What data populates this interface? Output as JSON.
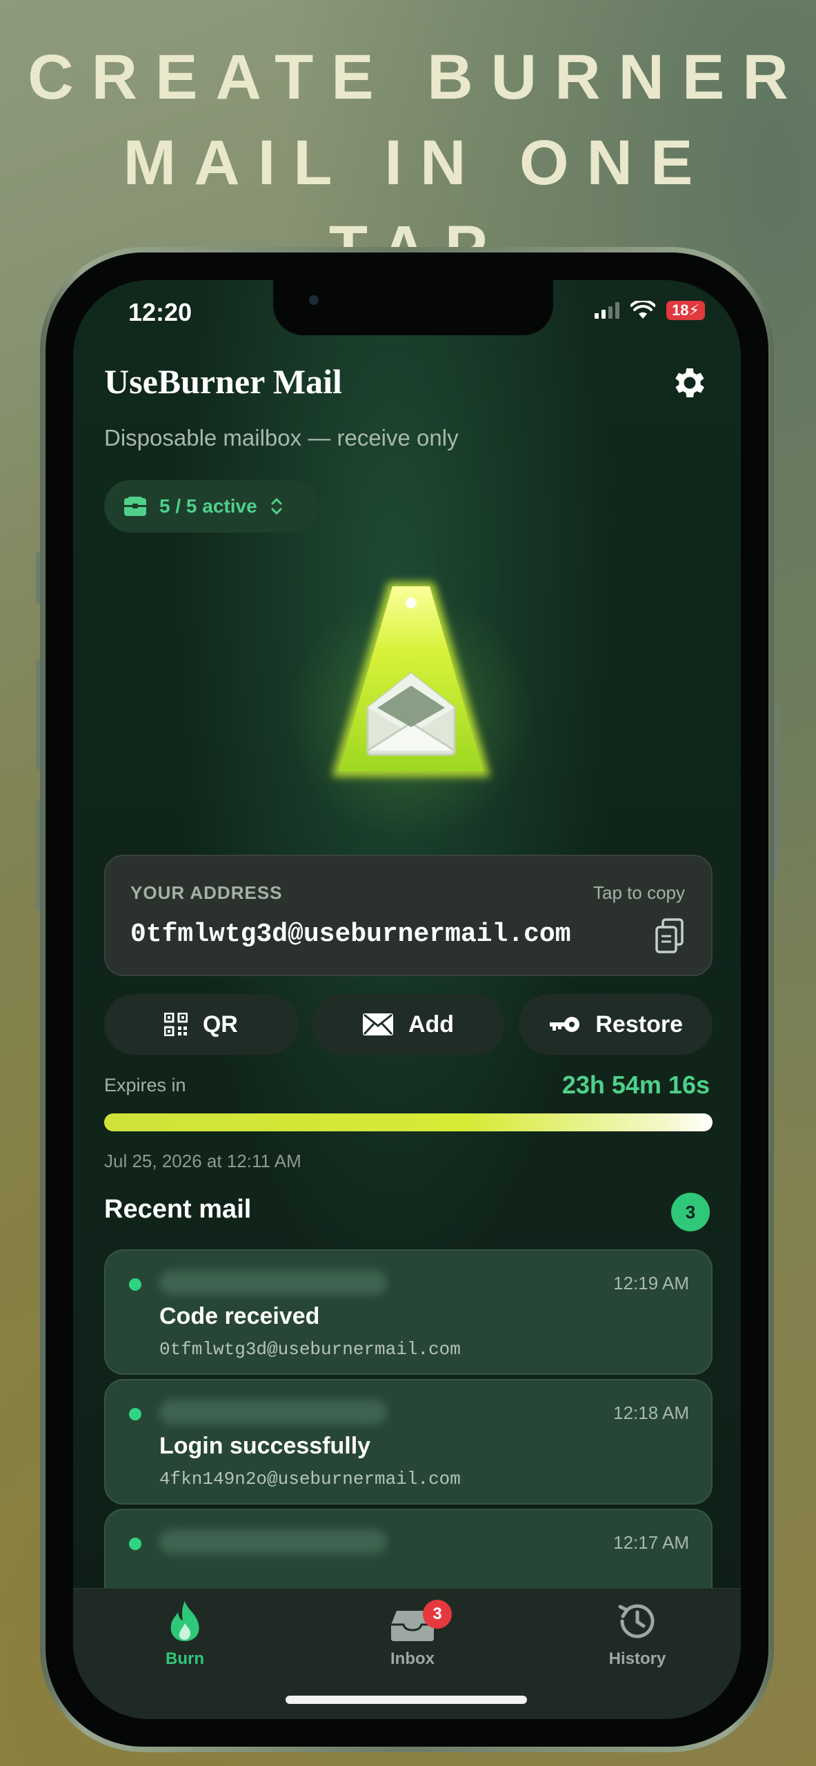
{
  "promo": {
    "line1": "CREATE BURNER",
    "line2": "MAIL IN ONE TAP"
  },
  "status_bar": {
    "time": "12:20",
    "battery": "18"
  },
  "header": {
    "title": "UseBurner Mail",
    "subtitle": "Disposable mailbox — receive only",
    "active_label": "5 / 5 active"
  },
  "address_card": {
    "label": "YOUR ADDRESS",
    "hint": "Tap to copy",
    "address": "0tfmlwtg3d@useburnermail.com"
  },
  "actions": {
    "qr": "QR",
    "add": "Add",
    "restore": "Restore"
  },
  "expiry": {
    "label": "Expires in",
    "countdown": "23h 54m 16s",
    "date": "Jul 25, 2026 at 12:11 AM",
    "progress": 1.0
  },
  "recent": {
    "title": "Recent mail",
    "count": "3",
    "items": [
      {
        "time": "12:19 AM",
        "subject": "Code received",
        "to": "0tfmlwtg3d@useburnermail.com"
      },
      {
        "time": "12:18 AM",
        "subject": "Login successfully",
        "to": "4fkn149n2o@useburnermail.com"
      },
      {
        "time": "12:17 AM",
        "subject": "",
        "to": ""
      }
    ]
  },
  "tabbar": {
    "burn": "Burn",
    "inbox": "Inbox",
    "inbox_badge": "3",
    "history": "History"
  },
  "colors": {
    "accent": "#2fc879",
    "warning": "#e5393f"
  }
}
